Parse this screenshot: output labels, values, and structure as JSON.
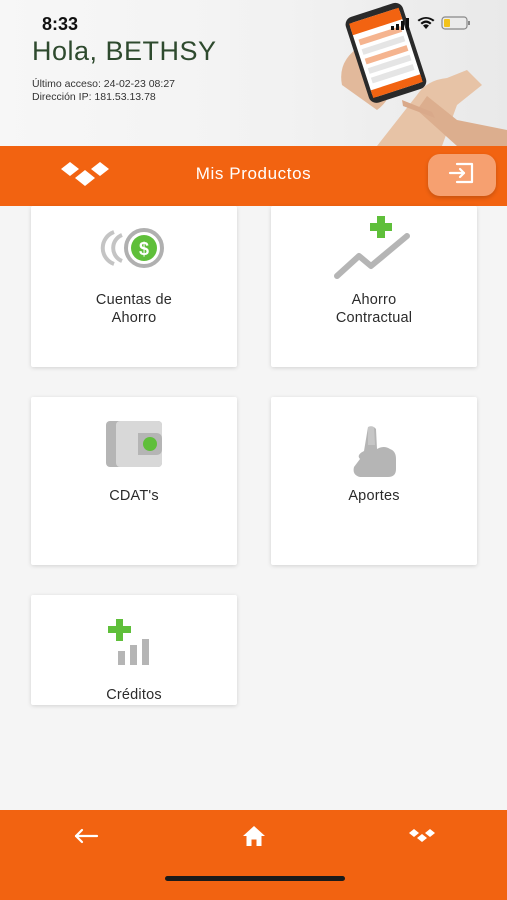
{
  "status_bar": {
    "time": "8:33",
    "icons": [
      "signal-icon",
      "wifi-icon",
      "battery-icon"
    ]
  },
  "header": {
    "greeting": "Hola, BETHSY",
    "last_access": "Último acceso: 24-02-23 08:27",
    "ip_address": "Dirección IP: 181.53.13.78"
  },
  "toolbar": {
    "title": "Mis Productos",
    "logo_icon": "brand-diamonds-icon",
    "exit_icon": "logout-icon"
  },
  "products": [
    {
      "id": "cuentas",
      "line1": "Cuentas de",
      "line2": "Ahorro",
      "icon": "savings-coin-icon"
    },
    {
      "id": "ahorro-contractual",
      "line1": "Ahorro",
      "line2": "Contractual",
      "icon": "growth-chart-icon"
    },
    {
      "id": "cdats",
      "line1": "CDAT's",
      "line2": "",
      "icon": "wallet-icon"
    },
    {
      "id": "aportes",
      "line1": "Aportes",
      "line2": "",
      "icon": "hand-point-icon"
    },
    {
      "id": "creditos",
      "line1": "Créditos",
      "line2": "",
      "icon": "credit-bars-icon"
    }
  ],
  "bottom_nav": {
    "back_icon": "arrow-left-icon",
    "home_icon": "home-icon",
    "logo_icon": "brand-diamonds-icon"
  },
  "colors": {
    "brand_orange": "#f26311",
    "exit_button": "#f6a070",
    "icon_green": "#5fbf3a",
    "icon_gray": "#b5b5b5",
    "greeting_text": "#2e4a2e"
  }
}
